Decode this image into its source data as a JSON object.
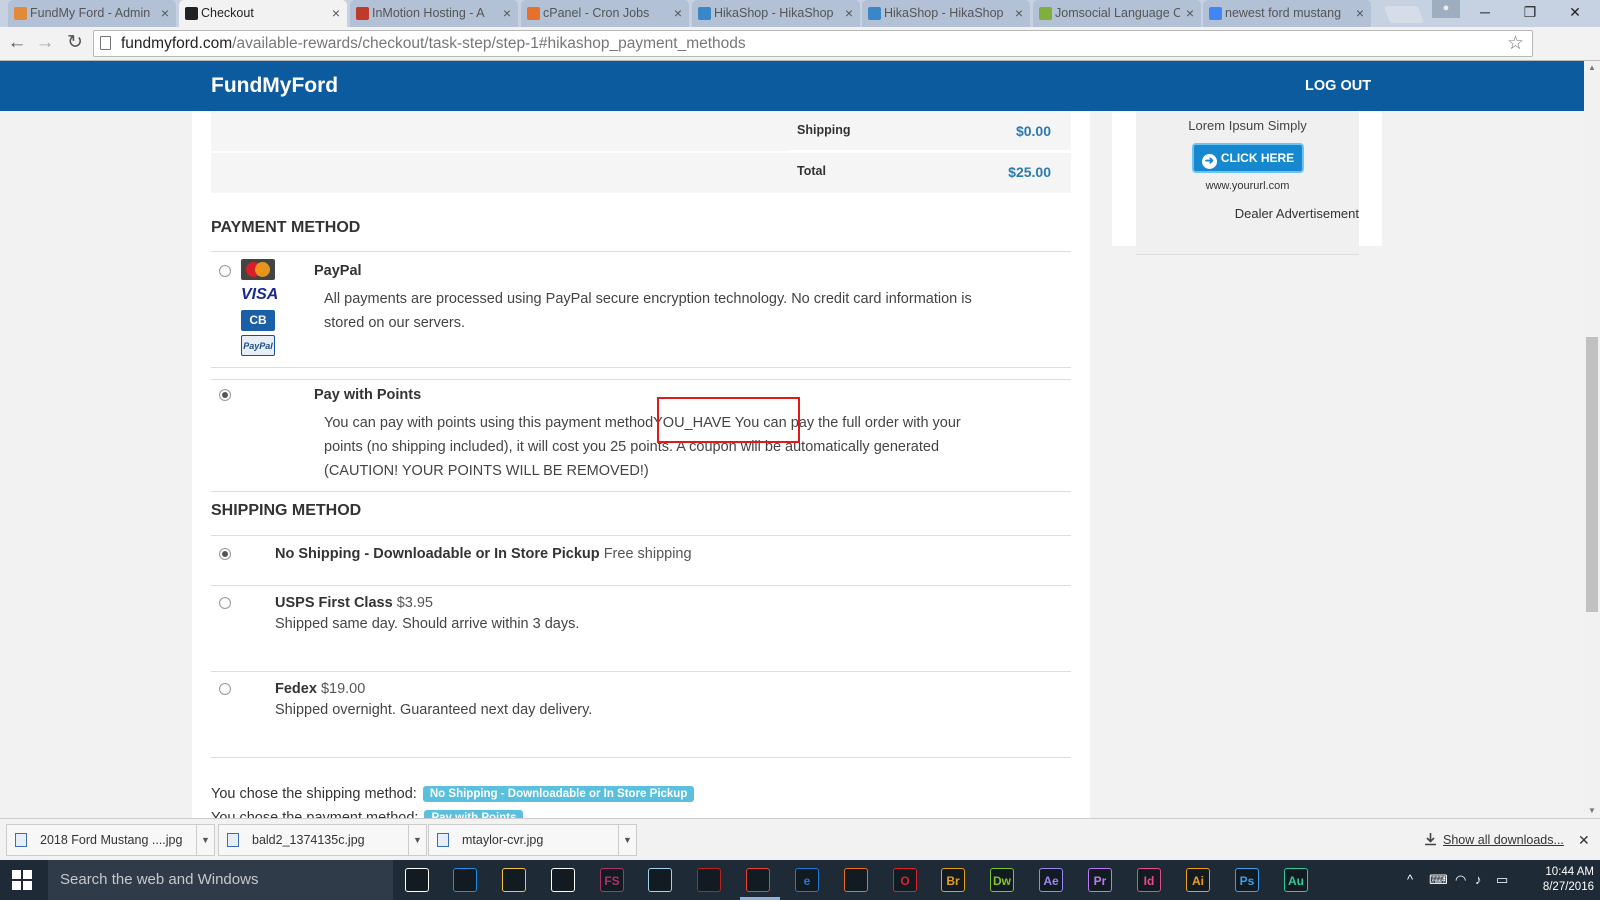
{
  "browser": {
    "tabs": [
      {
        "title": "FundMy Ford - Admin",
        "icon": "joomla-icon",
        "color": "#e08a3a",
        "active": false
      },
      {
        "title": "Checkout",
        "icon": "site-favicon",
        "color": "#222222",
        "active": true
      },
      {
        "title": "InMotion Hosting - A",
        "icon": "inmotion-icon",
        "color": "#c0392b",
        "active": false
      },
      {
        "title": "cPanel - Cron Jobs",
        "icon": "cpanel-icon",
        "color": "#e8702a",
        "active": false
      },
      {
        "title": "HikaShop - HikaShop",
        "icon": "hikashop-icon",
        "color": "#3a87c8",
        "active": false
      },
      {
        "title": "HikaShop - HikaShop",
        "icon": "hikashop-icon",
        "color": "#3a87c8",
        "active": false
      },
      {
        "title": "Jomsocial Language C",
        "icon": "jomsocial-icon",
        "color": "#7fb03a",
        "active": false
      },
      {
        "title": "newest ford mustang",
        "icon": "google-icon",
        "color": "#4285f4",
        "active": false
      }
    ],
    "url_host": "fundmyford.com",
    "url_path": "/available-rewards/checkout/task-step/step-1#hikashop_payment_methods"
  },
  "site": {
    "brand": "FundMyFord",
    "logout": "LOG OUT"
  },
  "summary": {
    "shipping_label": "Shipping",
    "shipping_value": "$0.00",
    "total_label": "Total",
    "total_value": "$25.00"
  },
  "payment": {
    "heading": "PAYMENT METHOD",
    "paypal": {
      "title": "PayPal",
      "line1": "All payments are processed using PayPal secure encryption technology. No credit card information is",
      "line2": "stored on our servers.",
      "cards": [
        "MasterCard",
        "VISA",
        "CB",
        "PayPal"
      ],
      "selected": false
    },
    "points": {
      "title": "Pay with Points",
      "line1": "You can pay with points using this payment methodYOU_HAVE You can pay the full order with your",
      "line2": "points (no shipping included), it will cost you 25 points. A coupon will be automatically generated",
      "line3": "(CAUTION! YOUR POINTS WILL BE REMOVED!)",
      "selected": true
    }
  },
  "shipping": {
    "heading": "SHIPPING METHOD",
    "methods": [
      {
        "name": "No Shipping - Downloadable or In Store Pickup",
        "price": "Free shipping",
        "desc": "",
        "selected": true
      },
      {
        "name": "USPS First Class",
        "price": "$3.95",
        "desc": "Shipped same day. Should arrive within 3 days.",
        "selected": false
      },
      {
        "name": "Fedex",
        "price": "$19.00",
        "desc": "Shipped overnight. Guaranteed next day delivery.",
        "selected": false
      }
    ]
  },
  "chosen": {
    "shipping_text": "You chose the shipping method:",
    "shipping_badge": "No Shipping - Downloadable or In Store Pickup",
    "payment_text": "You chose the payment method:",
    "payment_badge": "Pay with Points"
  },
  "ad": {
    "text": "Lorem Ipsum Simply",
    "button": "CLICK HERE",
    "url": "www.yoururl.com",
    "caption": "Dealer Advertisement"
  },
  "downloads": {
    "items": [
      "2018 Ford Mustang ....jpg",
      "bald2_1374135c.jpg",
      "mtaylor-cvr.jpg"
    ],
    "show_all": "Show all downloads..."
  },
  "taskbar": {
    "search": "Search the web and Windows",
    "apps": [
      {
        "icon": "task-view-icon",
        "label": "",
        "color": "#ffffff"
      },
      {
        "icon": "dropbox-icon",
        "label": "",
        "color": "#1f8ce6"
      },
      {
        "icon": "file-explorer-icon",
        "label": "",
        "color": "#f5c342"
      },
      {
        "icon": "store-icon",
        "label": "",
        "color": "#ffffff"
      },
      {
        "icon": "fs-icon",
        "label": "FS",
        "color": "#b0306a"
      },
      {
        "icon": "notepad-icon",
        "label": "",
        "color": "#9fd3f0"
      },
      {
        "icon": "filezilla-icon",
        "label": "",
        "color": "#bf1e1e"
      },
      {
        "icon": "chrome-icon",
        "label": "",
        "color": "#e94235"
      },
      {
        "icon": "edge-icon",
        "label": "e",
        "color": "#1f7ad6"
      },
      {
        "icon": "firefox-icon",
        "label": "",
        "color": "#e8701d"
      },
      {
        "icon": "opera-icon",
        "label": "O",
        "color": "#e0202a"
      },
      {
        "icon": "bridge-icon",
        "label": "Br",
        "color": "#e5a019"
      },
      {
        "icon": "dreamweaver-icon",
        "label": "Dw",
        "color": "#7fc32f"
      },
      {
        "icon": "aftereffects-icon",
        "label": "Ae",
        "color": "#9a86f0"
      },
      {
        "icon": "premiere-icon",
        "label": "Pr",
        "color": "#b97cf0"
      },
      {
        "icon": "indesign-icon",
        "label": "Id",
        "color": "#e84a8e"
      },
      {
        "icon": "illustrator-icon",
        "label": "Ai",
        "color": "#f29f1a"
      },
      {
        "icon": "photoshop-icon",
        "label": "Ps",
        "color": "#3aa0f0"
      },
      {
        "icon": "audition-icon",
        "label": "Au",
        "color": "#2fc9a0"
      }
    ],
    "time": "10:44 AM",
    "date": "8/27/2016"
  }
}
